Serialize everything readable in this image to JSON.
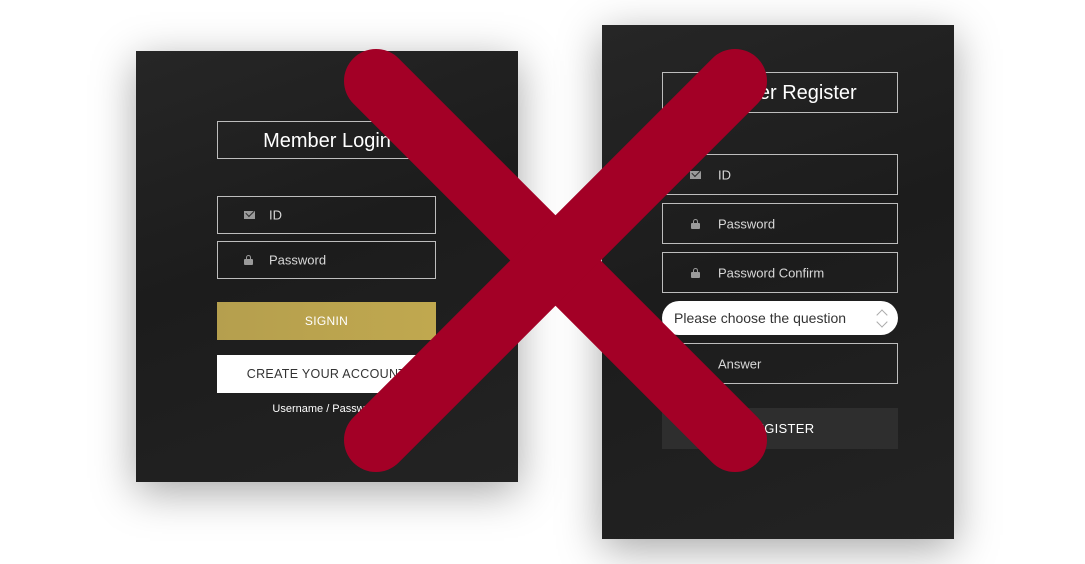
{
  "login": {
    "title": "Member Login",
    "id_placeholder": "ID",
    "password_placeholder": "Password",
    "signin_label": "SIGNIN",
    "create_account_label": "CREATE YOUR ACCOUNT",
    "forgot_text": "Username / Password"
  },
  "register": {
    "title": "Member Register",
    "id_placeholder": "ID",
    "password_placeholder": "Password",
    "password_confirm_placeholder": "Password Confirm",
    "question_select": "Please choose the question",
    "answer_placeholder": "Answer",
    "register_label": "REGISTER"
  },
  "colors": {
    "panel_bg": "#1f1f1f",
    "signin_gold": "#b8a24f",
    "x_mark": "#a30026"
  },
  "icons": [
    "envelope-icon",
    "lock-icon",
    "select-arrows-icon",
    "cross-mark"
  ]
}
